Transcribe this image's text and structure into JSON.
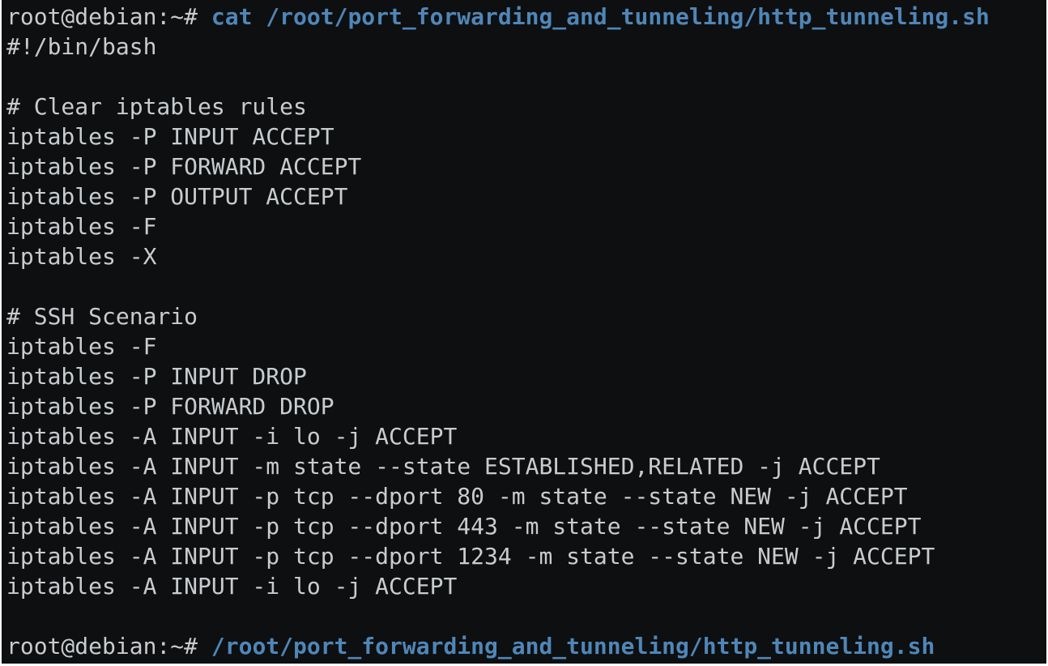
{
  "terminal": {
    "prompt1": "root@debian:~# ",
    "command1": "cat /root/port_forwarding_and_tunneling/http_tunneling.sh",
    "script_lines": [
      "#!/bin/bash",
      "",
      "# Clear iptables rules",
      "iptables -P INPUT ACCEPT",
      "iptables -P FORWARD ACCEPT",
      "iptables -P OUTPUT ACCEPT",
      "iptables -F",
      "iptables -X",
      "",
      "# SSH Scenario",
      "iptables -F",
      "iptables -P INPUT DROP",
      "iptables -P FORWARD DROP",
      "iptables -A INPUT -i lo -j ACCEPT",
      "iptables -A INPUT -m state --state ESTABLISHED,RELATED -j ACCEPT",
      "iptables -A INPUT -p tcp --dport 80 -m state --state NEW -j ACCEPT",
      "iptables -A INPUT -p tcp --dport 443 -m state --state NEW -j ACCEPT",
      "iptables -A INPUT -p tcp --dport 1234 -m state --state NEW -j ACCEPT",
      "iptables -A INPUT -i lo -j ACCEPT",
      ""
    ],
    "prompt2": "root@debian:~# ",
    "command2": "/root/port_forwarding_and_tunneling/http_tunneling.sh"
  },
  "colors": {
    "background": "#0d0f10",
    "text": "#c9cccf",
    "command": "#4f86b8"
  }
}
